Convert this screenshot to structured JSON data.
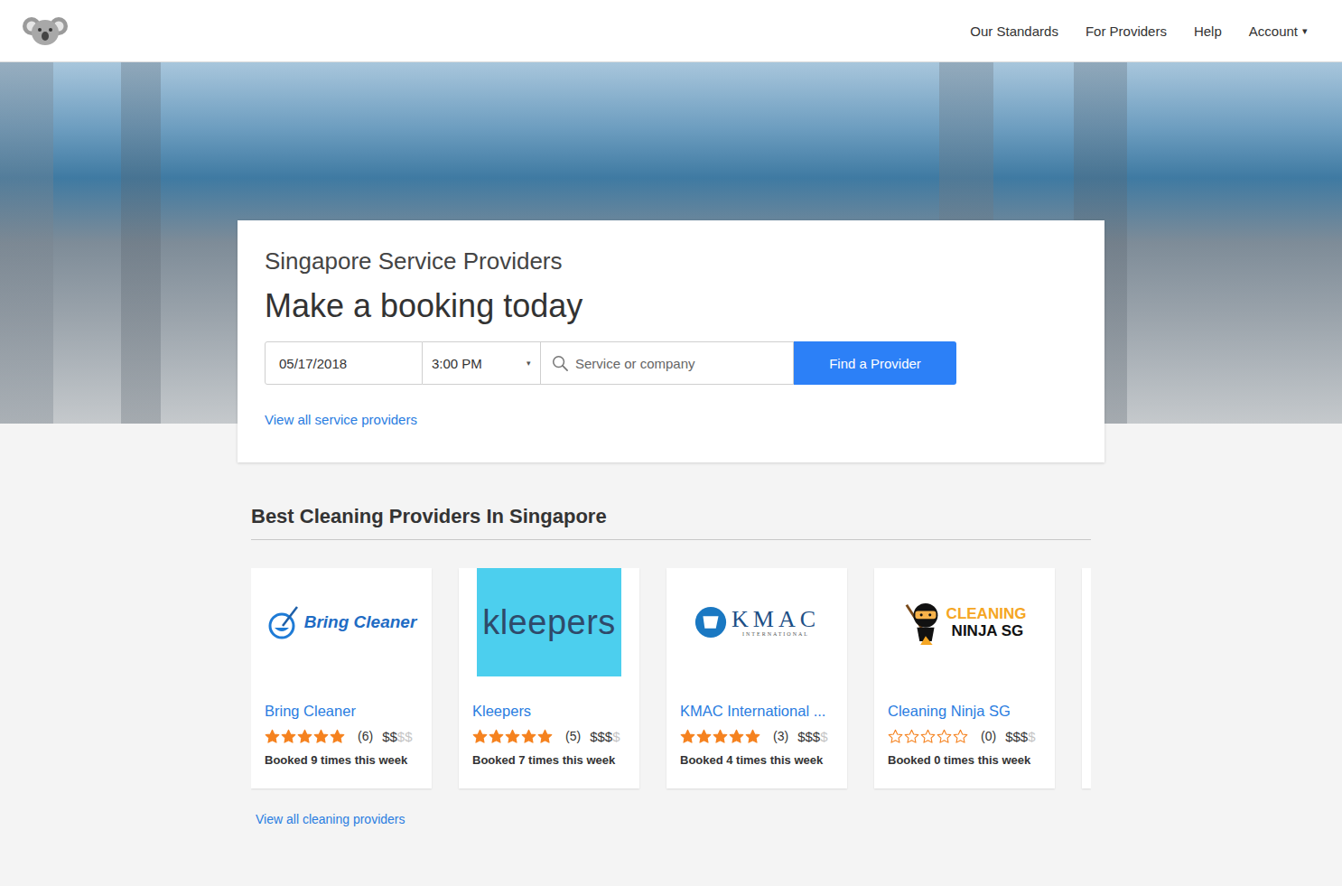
{
  "header": {
    "nav": [
      "Our Standards",
      "For Providers",
      "Help"
    ],
    "account": {
      "label": "Account",
      "caret": "▾"
    }
  },
  "booking": {
    "subtitle": "Singapore Service Providers",
    "title": "Make a booking today",
    "date": "05/17/2018",
    "time": "3:00 PM",
    "time_caret": "▾",
    "search_placeholder": "Service or company",
    "button": "Find a Provider",
    "link": "View all service providers"
  },
  "section": {
    "title": "Best Cleaning Providers In Singapore",
    "link": "View all cleaning providers"
  },
  "providers": [
    {
      "name": "Bring Cleaner",
      "logo": {
        "kind": "bring",
        "lines": [
          "Bring Cleaner"
        ]
      },
      "stars": 5,
      "rating_count": "(6)",
      "price_active": "$$",
      "price_inactive": "$$",
      "booked": "Booked 9 times this week"
    },
    {
      "name": "Kleepers",
      "logo": {
        "kind": "kleepers",
        "lines": [
          "kleepers"
        ]
      },
      "stars": 5,
      "rating_count": "(5)",
      "price_active": "$$$",
      "price_inactive": "$",
      "booked": "Booked 7 times this week"
    },
    {
      "name": "KMAC International ...",
      "logo": {
        "kind": "kmac",
        "lines": [
          "KMAC",
          "INTERNATIONAL"
        ]
      },
      "stars": 5,
      "rating_count": "(3)",
      "price_active": "$$$",
      "price_inactive": "$",
      "booked": "Booked 4 times this week"
    },
    {
      "name": "Cleaning Ninja SG",
      "logo": {
        "kind": "ninja",
        "lines": [
          "CLEANING",
          "NINJA SG"
        ]
      },
      "stars": 0,
      "rating_count": "(0)",
      "price_active": "$$$",
      "price_inactive": "$",
      "booked": "Booked 0 times this week"
    }
  ]
}
